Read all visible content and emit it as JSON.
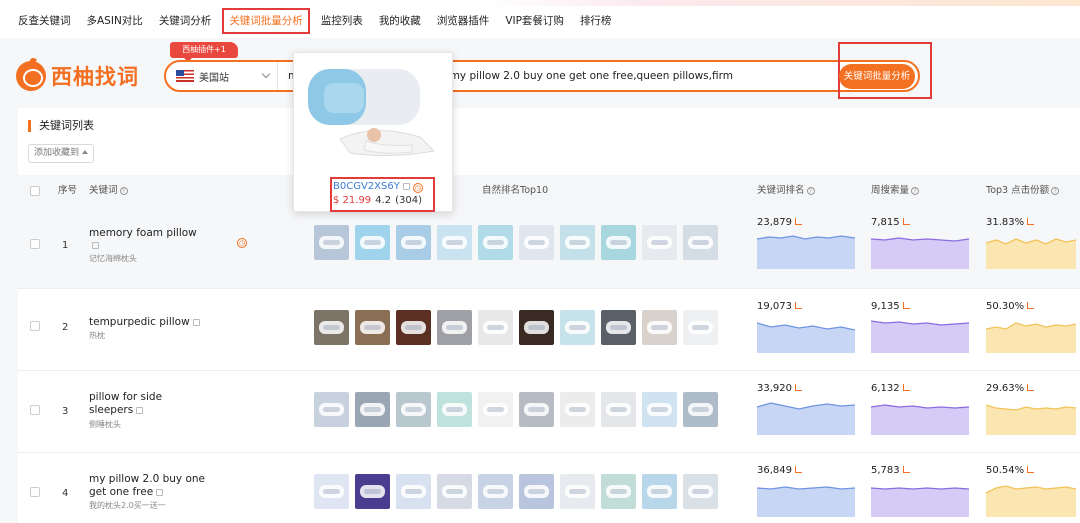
{
  "nav": {
    "items": [
      "反查关键词",
      "多ASIN对比",
      "关键词分析",
      "关键词批量分析",
      "监控列表",
      "我的收藏",
      "浏览器插件",
      "VIP套餐订购",
      "排行榜"
    ],
    "active_index": 3
  },
  "brand": {
    "name": "西柚找词",
    "accent_color": "#f37021"
  },
  "promo_tag": "西柚插件+1",
  "search": {
    "site": "美国站",
    "flag_icon": "us-flag-icon",
    "query": "m                              llow,pillow for side sleepers,my pillow 2.0 buy one get one free,queen pillows,firm",
    "button_label": "关键词批量分析"
  },
  "list": {
    "title": "关键词列表",
    "fav_button": "添加收藏到"
  },
  "table": {
    "headers": {
      "index": "序号",
      "keyword": "关键词",
      "top10": "自然排名Top10",
      "rank": "关键词排名",
      "weekly": "周搜索量",
      "top3": "Top3 点击份额"
    },
    "rows": [
      {
        "index": "1",
        "keyword": "memory foam pillow",
        "translation": "记忆海绵枕头",
        "rank": "23,879",
        "weekly": "7,815",
        "top3": "31.83%"
      },
      {
        "index": "2",
        "keyword": "tempurpedic pillow",
        "translation": "热枕",
        "rank": "19,073",
        "weekly": "9,135",
        "top3": "50.30%"
      },
      {
        "index": "3",
        "keyword": "pillow for side sleepers",
        "translation": "侧睡枕头",
        "rank": "33,920",
        "weekly": "6,132",
        "top3": "29.63%"
      },
      {
        "index": "4",
        "keyword": "my pillow 2.0 buy one get one free",
        "translation": "我的枕头2.0买一送一",
        "rank": "36,849",
        "weekly": "5,783",
        "top3": "50.54%"
      }
    ]
  },
  "popup": {
    "asin": "B0CGV2XS6Y",
    "price": "$ 21.99",
    "rating": "4.2",
    "reviews": "(304)"
  },
  "colors": {
    "rank": "#6f94e0",
    "weekly": "#8a6be0",
    "top3": "#f2c35a",
    "highlight": "#e23b3b"
  }
}
